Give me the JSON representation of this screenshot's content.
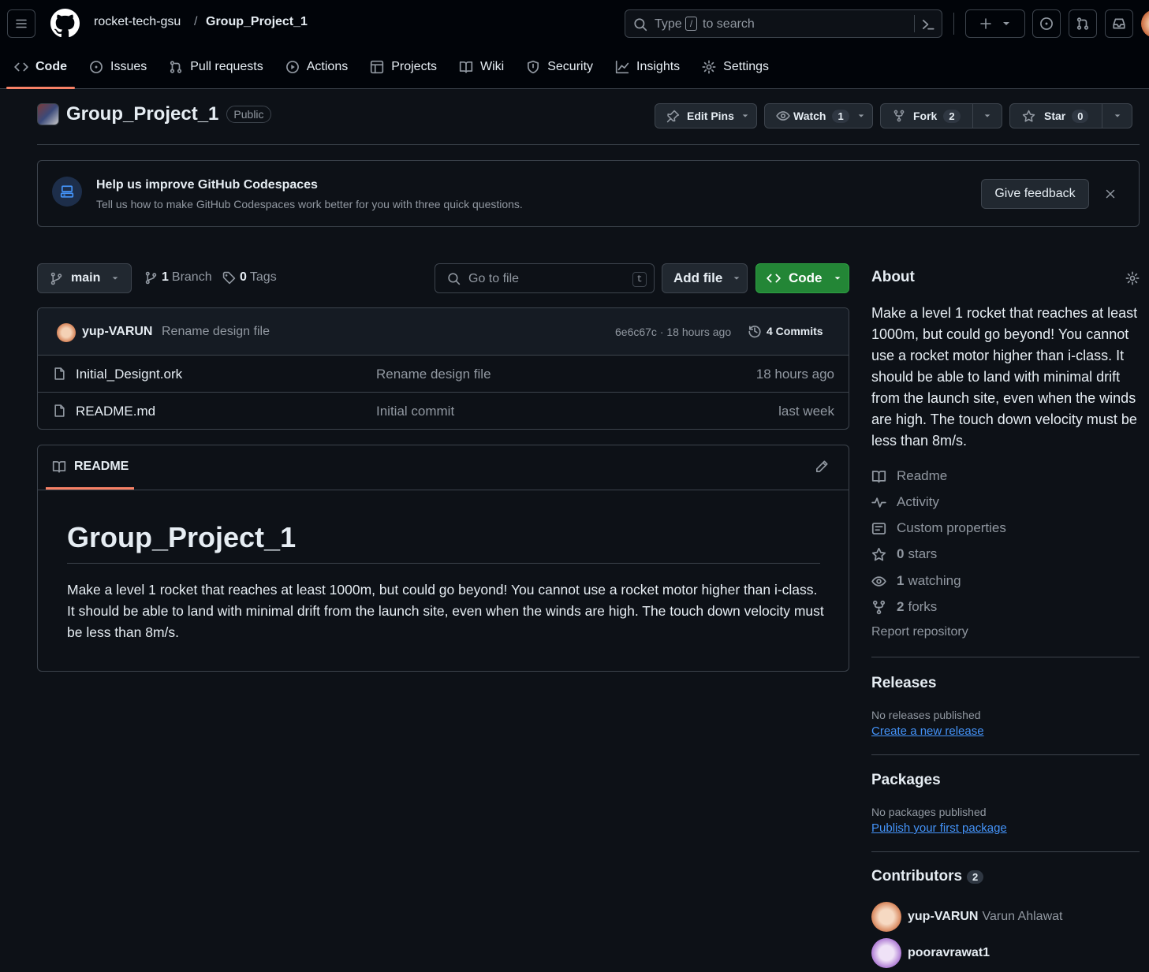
{
  "header": {
    "org": "rocket-tech-gsu",
    "separator": "/",
    "repo": "Group_Project_1",
    "search_prefix": "Type",
    "search_key": "/",
    "search_suffix": "to search"
  },
  "tabs": [
    {
      "label": "Code",
      "icon": "code-icon",
      "selected": true
    },
    {
      "label": "Issues",
      "icon": "issue-icon"
    },
    {
      "label": "Pull requests",
      "icon": "pull-request-icon"
    },
    {
      "label": "Actions",
      "icon": "play-icon"
    },
    {
      "label": "Projects",
      "icon": "table-icon"
    },
    {
      "label": "Wiki",
      "icon": "book-icon"
    },
    {
      "label": "Security",
      "icon": "shield-icon"
    },
    {
      "label": "Insights",
      "icon": "graph-icon"
    },
    {
      "label": "Settings",
      "icon": "gear-icon"
    }
  ],
  "repo": {
    "name": "Group_Project_1",
    "visibility": "Public",
    "edit_pins": "Edit Pins",
    "watch": "Watch",
    "watch_count": "1",
    "fork": "Fork",
    "fork_count": "2",
    "star": "Star",
    "star_count": "0"
  },
  "banner": {
    "title": "Help us improve GitHub Codespaces",
    "text": "Tell us how to make GitHub Codespaces work better for you with three quick questions.",
    "button": "Give feedback"
  },
  "toolbar": {
    "branch": "main",
    "branch_count": "1",
    "branch_label": "Branch",
    "tag_count": "0",
    "tag_label": "Tags",
    "go_to_file": "Go to file",
    "go_to_file_key": "t",
    "add_file": "Add file",
    "code": "Code"
  },
  "commit": {
    "author": "yup-VARUN",
    "message": "Rename design file",
    "meta": "6e6c67c · 18 hours ago",
    "commits": "4 Commits"
  },
  "files": [
    {
      "name": "Initial_Designt.ork",
      "message": "Rename design file",
      "time": "18 hours ago"
    },
    {
      "name": "README.md",
      "message": "Initial commit",
      "time": "last week"
    }
  ],
  "readme": {
    "tab": "README",
    "heading": "Group_Project_1",
    "body": "Make a level 1 rocket that reaches at least 1000m, but could go beyond! You cannot use a rocket motor higher than i-class. It should be able to land with minimal drift from the launch site, even when the winds are high. The touch down velocity must be less than 8m/s."
  },
  "about": {
    "title": "About",
    "description": "Make a level 1 rocket that reaches at least 1000m, but could go beyond! You cannot use a rocket motor higher than i-class. It should be able to land with minimal drift from the launch site, even when the winds are high. The touch down velocity must be less than 8m/s.",
    "readme": "Readme",
    "activity": "Activity",
    "custom_properties": "Custom properties",
    "stars_count": "0",
    "stars_label": "stars",
    "watching_count": "1",
    "watching_label": "watching",
    "forks_count": "2",
    "forks_label": "forks",
    "report": "Report repository"
  },
  "releases": {
    "title": "Releases",
    "none": "No releases published",
    "create": "Create a new release"
  },
  "packages": {
    "title": "Packages",
    "none": "No packages published",
    "publish": "Publish your first package"
  },
  "contributors": {
    "title": "Contributors",
    "count": "2",
    "people": [
      {
        "login": "yup-VARUN",
        "name": "Varun Ahlawat"
      },
      {
        "login": "pooravrawat1",
        "name": ""
      }
    ]
  },
  "colors": {
    "accent_green": "#238636",
    "link_blue": "#4493f8",
    "tab_underline": "#f78166"
  }
}
